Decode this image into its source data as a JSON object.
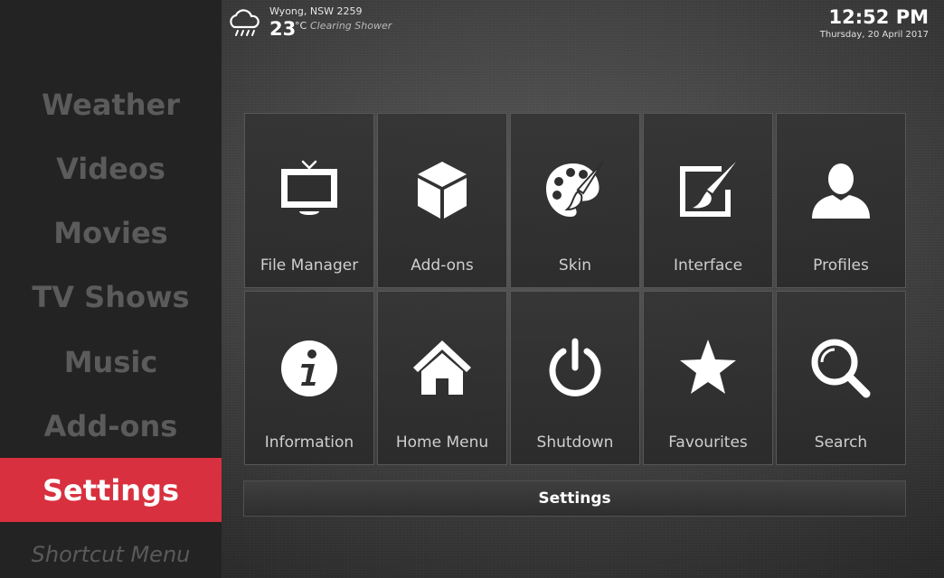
{
  "sidebar": {
    "items": [
      {
        "label": "Weather"
      },
      {
        "label": "Videos"
      },
      {
        "label": "Movies"
      },
      {
        "label": "TV Shows"
      },
      {
        "label": "Music"
      },
      {
        "label": "Add-ons"
      },
      {
        "label": "Settings",
        "active": true
      }
    ],
    "shortcut_label": "Shortcut Menu"
  },
  "weather": {
    "icon": "cloud-rain-icon",
    "location": "Wyong, NSW 2259",
    "temperature": "23",
    "unit": "°C",
    "condition": "Clearing Shower"
  },
  "clock": {
    "time": "12:52 PM",
    "date": "Thursday, 20 April 2017"
  },
  "settings_grid": [
    {
      "label": "File Manager",
      "icon": "tv-icon"
    },
    {
      "label": "Add-ons",
      "icon": "cube-icon"
    },
    {
      "label": "Skin",
      "icon": "palette-icon"
    },
    {
      "label": "Interface",
      "icon": "paint-frame-icon"
    },
    {
      "label": "Profiles",
      "icon": "user-icon"
    },
    {
      "label": "Information",
      "icon": "info-icon"
    },
    {
      "label": "Home Menu",
      "icon": "home-icon"
    },
    {
      "label": "Shutdown",
      "icon": "power-icon"
    },
    {
      "label": "Favourites",
      "icon": "star-icon"
    },
    {
      "label": "Search",
      "icon": "search-icon"
    }
  ],
  "title_bar": {
    "label": "Settings"
  },
  "colors": {
    "accent": "#d8303f",
    "sidebar_bg": "#232323",
    "menu_text_inactive": "#5b5b5b"
  }
}
